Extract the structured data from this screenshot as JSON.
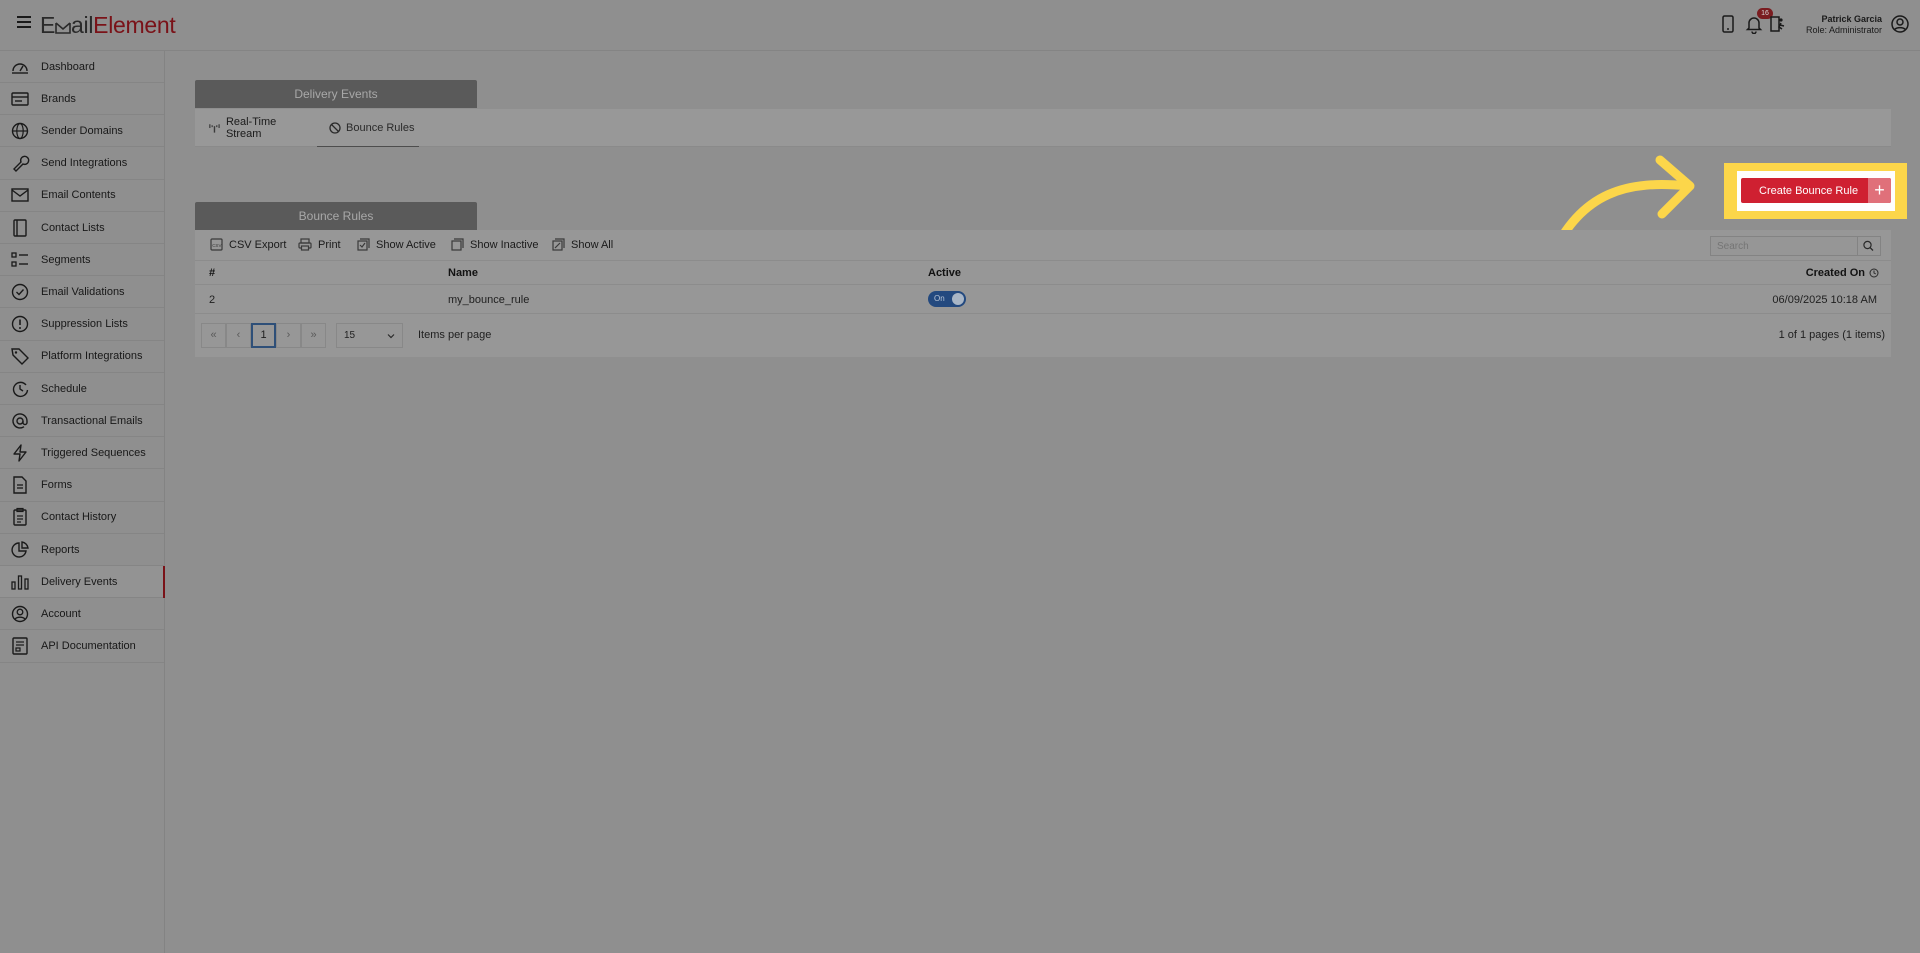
{
  "app": {
    "logo_part1": "E",
    "logo_part2": "ail",
    "logo_part3": "Element",
    "notification_count": "16"
  },
  "user": {
    "name": "Patrick Garcia",
    "role": "Role: Administrator"
  },
  "sidebar": {
    "items": [
      {
        "label": "Dashboard",
        "icon": "gauge-icon"
      },
      {
        "label": "Brands",
        "icon": "brands-icon"
      },
      {
        "label": "Sender Domains",
        "icon": "globe-icon"
      },
      {
        "label": "Send Integrations",
        "icon": "wrench-icon"
      },
      {
        "label": "Email Contents",
        "icon": "envelope-icon"
      },
      {
        "label": "Contact Lists",
        "icon": "book-icon"
      },
      {
        "label": "Segments",
        "icon": "list-icon"
      },
      {
        "label": "Email Validations",
        "icon": "check-circle-icon"
      },
      {
        "label": "Suppression Lists",
        "icon": "alert-circle-icon"
      },
      {
        "label": "Platform Integrations",
        "icon": "tag-icon"
      },
      {
        "label": "Schedule",
        "icon": "schedule-icon"
      },
      {
        "label": "Transactional Emails",
        "icon": "at-icon"
      },
      {
        "label": "Triggered Sequences",
        "icon": "bolt-icon"
      },
      {
        "label": "Forms",
        "icon": "form-icon"
      },
      {
        "label": "Contact History",
        "icon": "clipboard-icon"
      },
      {
        "label": "Reports",
        "icon": "pie-chart-icon"
      },
      {
        "label": "Delivery Events",
        "icon": "bar-chart-icon"
      },
      {
        "label": "Account",
        "icon": "user-circle-icon"
      },
      {
        "label": "API Documentation",
        "icon": "api-doc-icon"
      }
    ],
    "active_index": 16
  },
  "delivery_events": {
    "title": "Delivery Events",
    "tabs": [
      {
        "label": "Real-Time Stream",
        "icon": "antenna-icon"
      },
      {
        "label": "Bounce Rules",
        "icon": "ban-icon"
      }
    ],
    "active_tab": 1
  },
  "create_button": {
    "label": "Create Bounce Rule",
    "plus": "+"
  },
  "bounce_rules": {
    "title": "Bounce Rules",
    "toolbar": {
      "csv_export": "CSV Export",
      "print": "Print",
      "show_active": "Show Active",
      "show_inactive": "Show Inactive",
      "show_all": "Show All"
    },
    "search_placeholder": "Search",
    "columns": {
      "number": "#",
      "name": "Name",
      "active": "Active",
      "created_on": "Created On"
    },
    "rows": [
      {
        "number": "2",
        "name": "my_bounce_rule",
        "active": "On",
        "created_on": "06/09/2025 10:18 AM"
      }
    ],
    "pager": {
      "first": "«",
      "prev": "‹",
      "current_page": "1",
      "next": "›",
      "last": "»",
      "page_size": "15",
      "items_per_page": "Items per page",
      "summary": "1 of 1 pages (1 items)"
    }
  },
  "colors": {
    "brand_red": "#cf2031",
    "highlight_yellow": "#fcd64a",
    "toggle_blue": "#23497f"
  }
}
